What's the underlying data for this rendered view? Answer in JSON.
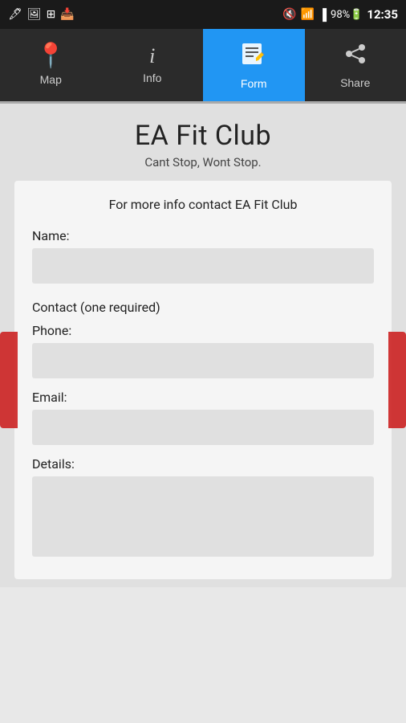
{
  "statusBar": {
    "battery": "98%",
    "time": "12:35",
    "icons": [
      "notification",
      "mute",
      "wifi",
      "signal"
    ]
  },
  "nav": {
    "items": [
      {
        "id": "map",
        "label": "Map",
        "icon": "📍",
        "active": false
      },
      {
        "id": "info",
        "label": "Info",
        "icon": "ℹ",
        "active": false
      },
      {
        "id": "form",
        "label": "Form",
        "icon": "📋",
        "active": true
      },
      {
        "id": "share",
        "label": "Share",
        "icon": "↗",
        "active": false
      }
    ]
  },
  "page": {
    "title": "EA Fit Club",
    "subtitle": "Cant Stop, Wont Stop.",
    "form": {
      "description": "For more info contact EA Fit Club",
      "fields": {
        "name_label": "Name:",
        "contact_section": "Contact (one required)",
        "phone_label": "Phone:",
        "email_label": "Email:",
        "details_label": "Details:"
      }
    }
  }
}
